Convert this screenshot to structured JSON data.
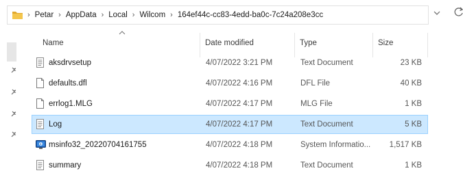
{
  "addressbar": {
    "breadcrumbs": [
      "Petar",
      "AppData",
      "Local",
      "Wilcom",
      "164ef44c-cc83-4edd-ba0c-7c24a208e3cc"
    ],
    "separator": "›",
    "dropdown_icon": "chevron-down-icon",
    "refresh_icon": "refresh-icon"
  },
  "columns": {
    "name": "Name",
    "date_modified": "Date modified",
    "type": "Type",
    "size": "Size",
    "sort": "name-ascending"
  },
  "files": [
    {
      "name": "aksdrvsetup",
      "date": "4/07/2022 3:21 PM",
      "type": "Text Document",
      "size": "23 KB",
      "icon": "text-file-icon",
      "selected": false
    },
    {
      "name": "defaults.dfl",
      "date": "4/07/2022 4:16 PM",
      "type": "DFL File",
      "size": "40 KB",
      "icon": "blank-file-icon",
      "selected": false
    },
    {
      "name": "errlog1.MLG",
      "date": "4/07/2022 4:17 PM",
      "type": "MLG File",
      "size": "1 KB",
      "icon": "blank-file-icon",
      "selected": false
    },
    {
      "name": "Log",
      "date": "4/07/2022 4:17 PM",
      "type": "Text Document",
      "size": "5 KB",
      "icon": "text-file-icon",
      "selected": true
    },
    {
      "name": "msinfo32_20220704161755",
      "date": "4/07/2022 4:18 PM",
      "type": "System Informatio...",
      "size": "1,517 KB",
      "icon": "system-info-icon",
      "selected": false
    },
    {
      "name": "summary",
      "date": "4/07/2022 4:18 PM",
      "type": "Text Document",
      "size": "1 KB",
      "icon": "text-file-icon",
      "selected": false
    }
  ],
  "colors": {
    "selection_bg": "#cce8ff",
    "selection_border": "#99d1ff",
    "folder": "#f4c64d"
  }
}
